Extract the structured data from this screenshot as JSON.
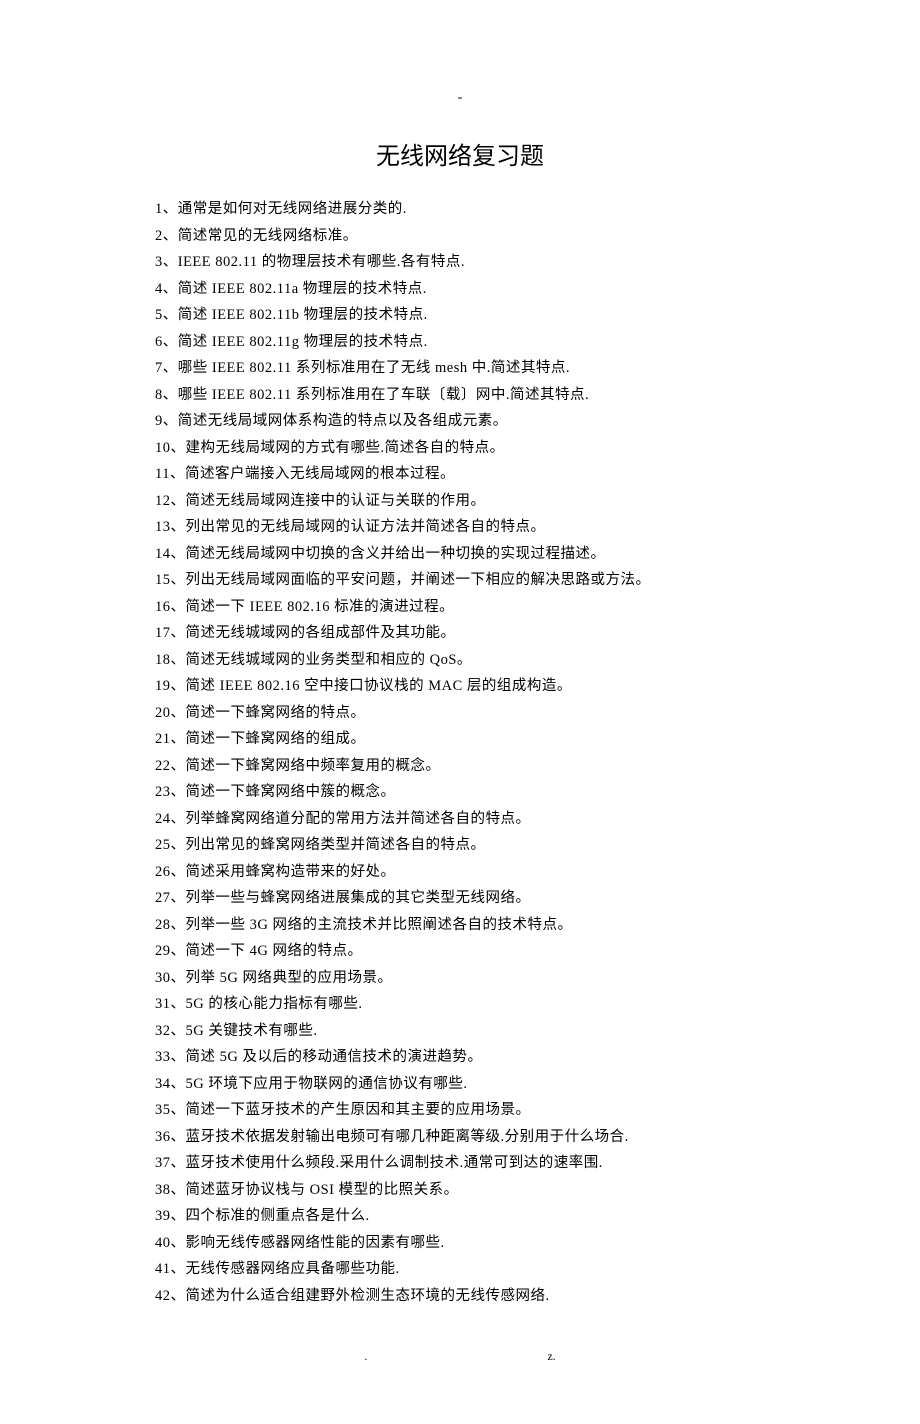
{
  "header_mark": "-",
  "title": "无线网络复习题",
  "items": [
    "1、通常是如何对无线网络进展分类的.",
    "2、简述常见的无线网络标准。",
    "3、IEEE 802.11 的物理层技术有哪些.各有特点.",
    "4、简述 IEEE 802.11a 物理层的技术特点.",
    "5、简述 IEEE 802.11b 物理层的技术特点.",
    "6、简述 IEEE 802.11g 物理层的技术特点.",
    "7、哪些 IEEE 802.11 系列标准用在了无线 mesh 中.简述其特点.",
    "8、哪些 IEEE 802.11 系列标准用在了车联〔载〕网中.简述其特点.",
    "9、简述无线局域网体系构造的特点以及各组成元素。",
    "10、建构无线局域网的方式有哪些.简述各自的特点。",
    "11、简述客户端接入无线局域网的根本过程。",
    "12、简述无线局域网连接中的认证与关联的作用。",
    "13、列出常见的无线局域网的认证方法并简述各自的特点。",
    "14、简述无线局域网中切换的含义并给出一种切换的实现过程描述。",
    "15、列出无线局域网面临的平安问题，并阐述一下相应的解决思路或方法。",
    "16、简述一下 IEEE 802.16 标准的演进过程。",
    "17、简述无线城域网的各组成部件及其功能。",
    "18、简述无线城域网的业务类型和相应的 QoS。",
    "19、简述 IEEE 802.16 空中接口协议栈的 MAC 层的组成构造。",
    "20、简述一下蜂窝网络的特点。",
    "21、简述一下蜂窝网络的组成。",
    "22、简述一下蜂窝网络中频率复用的概念。",
    "23、简述一下蜂窝网络中簇的概念。",
    "24、列举蜂窝网络道分配的常用方法并简述各自的特点。",
    "25、列出常见的蜂窝网络类型并简述各自的特点。",
    "26、简述采用蜂窝构造带来的好处。",
    "27、列举一些与蜂窝网络进展集成的其它类型无线网络。",
    "28、列举一些 3G 网络的主流技术并比照阐述各自的技术特点。",
    "29、简述一下 4G 网络的特点。",
    "30、列举 5G 网络典型的应用场景。",
    "31、5G 的核心能力指标有哪些.",
    "32、5G 关键技术有哪些.",
    "33、简述 5G 及以后的移动通信技术的演进趋势。",
    "34、5G 环境下应用于物联网的通信协议有哪些.",
    "35、简述一下蓝牙技术的产生原因和其主要的应用场景。",
    "36、蓝牙技术依据发射输出电频可有哪几种距离等级.分别用于什么场合.",
    "37、蓝牙技术使用什么频段.采用什么调制技术.通常可到达的速率围.",
    "38、简述蓝牙协议栈与 OSI 模型的比照关系。",
    "39、四个标准的侧重点各是什么.",
    "40、影响无线传感器网络性能的因素有哪些.",
    "41、无线传感器网络应具备哪些功能.",
    "42、简述为什么适合组建野外检测生态环境的无线传感网络."
  ],
  "footer_dot": ".",
  "footer_z": "z."
}
